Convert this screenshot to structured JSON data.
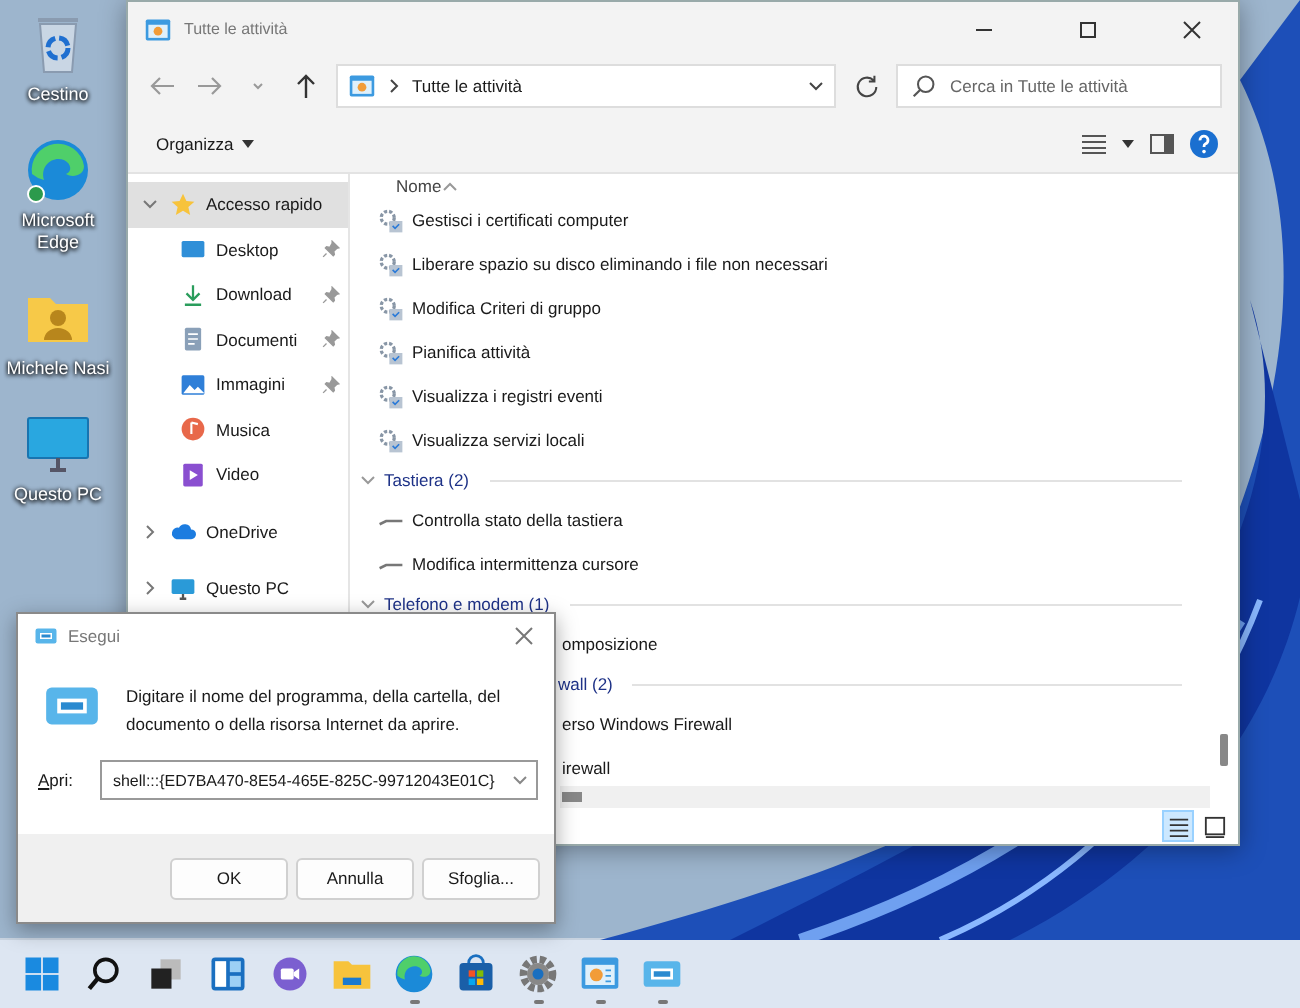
{
  "desktop_icons": [
    {
      "kind": "bin",
      "label": "Cestino"
    },
    {
      "kind": "edge",
      "label": "Microsoft Edge"
    },
    {
      "kind": "userfolder",
      "label": "Michele Nasi"
    },
    {
      "kind": "monitor",
      "label": "Questo PC"
    }
  ],
  "explorer": {
    "title": "Tutte le attività",
    "address": "Tutte le attività",
    "search": {
      "placeholder": "Cerca in Tutte le attività"
    },
    "toolbar": {
      "organize": "Organizza"
    },
    "nav": [
      {
        "kind": "star",
        "label": "Accesso rapido",
        "expanded": true,
        "selected": true,
        "children": [
          {
            "kind": "desktop",
            "label": "Desktop",
            "pinned": true,
            "selected": false
          },
          {
            "kind": "download",
            "label": "Download",
            "pinned": true,
            "selected": false
          },
          {
            "kind": "docs",
            "label": "Documenti",
            "pinned": true,
            "selected": false
          },
          {
            "kind": "pictures",
            "label": "Immagini",
            "pinned": true,
            "selected": false
          },
          {
            "kind": "music",
            "label": "Musica",
            "pinned": false,
            "selected": false
          },
          {
            "kind": "video",
            "label": "Video",
            "pinned": false,
            "selected": false
          }
        ]
      },
      {
        "kind": "cloud",
        "label": "OneDrive",
        "expanded": false,
        "selected": false
      },
      {
        "kind": "pc",
        "label": "Questo PC",
        "expanded": false,
        "selected": false
      }
    ],
    "column_header": "Nome",
    "rows": [
      {
        "kind": "tool",
        "label": "Gestisci i certificati computer"
      },
      {
        "kind": "tool",
        "label": "Liberare spazio su disco eliminando i file non necessari"
      },
      {
        "kind": "tool",
        "label": "Modifica Criteri di gruppo"
      },
      {
        "kind": "tool",
        "label": "Pianifica attività"
      },
      {
        "kind": "tool",
        "label": "Visualizza i registri eventi"
      },
      {
        "kind": "tool",
        "label": "Visualizza servizi locali"
      },
      {
        "kind": "group",
        "label": "Tastiera (2)",
        "expanded": true
      },
      {
        "kind": "keyboard",
        "label": "Controlla stato della tastiera"
      },
      {
        "kind": "keyboard",
        "label": "Modifica intermittenza cursore"
      },
      {
        "kind": "group",
        "label": "Telefono e modem (1)",
        "expanded": true
      },
      {
        "kind": "covered",
        "label": "omposizione"
      },
      {
        "kind": "covered-group",
        "label": "wall (2)"
      },
      {
        "kind": "covered",
        "label": "erso Windows Firewall"
      },
      {
        "kind": "covered",
        "label": "irewall"
      }
    ],
    "views": [
      {
        "kind": "details",
        "selected": true
      },
      {
        "kind": "tiles",
        "selected": false
      }
    ]
  },
  "run_dialog": {
    "title": "Esegui",
    "message": "Digitare il nome del programma, della cartella, del documento o della risorsa Internet da aprire.",
    "field_label": "Apri:",
    "value": "shell:::{ED7BA470-8E54-465E-825C-99712043E01C}",
    "buttons": [
      "OK",
      "Annulla",
      "Sfoglia..."
    ]
  },
  "taskbar": [
    {
      "kind": "start",
      "running": false
    },
    {
      "kind": "search",
      "running": false
    },
    {
      "kind": "taskview",
      "running": false
    },
    {
      "kind": "widgets",
      "running": false
    },
    {
      "kind": "chat",
      "running": false
    },
    {
      "kind": "folder",
      "running": false
    },
    {
      "kind": "edge",
      "running": true
    },
    {
      "kind": "store",
      "running": false
    },
    {
      "kind": "settings",
      "running": true
    },
    {
      "kind": "cpl",
      "running": true
    },
    {
      "kind": "run",
      "running": true
    }
  ]
}
